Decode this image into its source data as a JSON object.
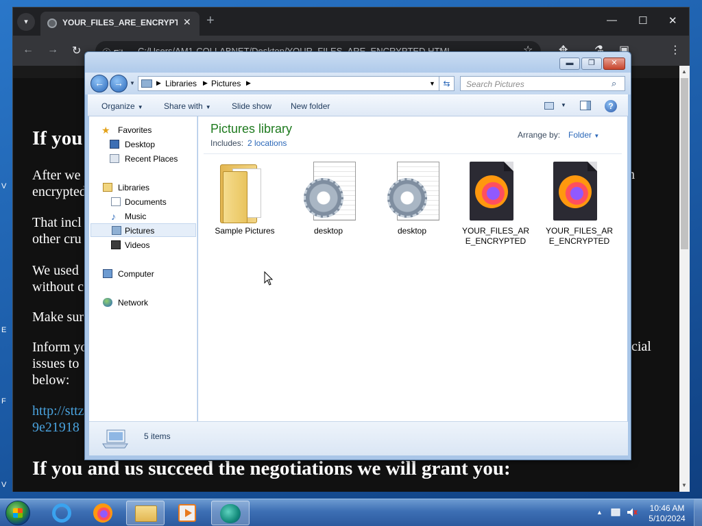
{
  "desktop": {
    "edge_letters": [
      "V",
      "E",
      "F",
      "V"
    ]
  },
  "chrome": {
    "tab": {
      "title": "YOUR_FILES_ARE_ENCRYPTED.H",
      "close": "✕"
    },
    "new_tab": "+",
    "window_controls": {
      "minimize": "—",
      "maximize": "☐",
      "close": "✕"
    },
    "toolbar": {
      "back": "←",
      "forward": "→",
      "reload": "↻",
      "info": "ⓘ File",
      "url": "C:/Users/AM1-COLLABNET/Desktop/YOUR_FILES_ARE_ENCRYPTED.HTML",
      "star": "☆",
      "icons": [
        "extensions-icon",
        "flask-icon",
        "sidepanel-icon",
        "profile-icon",
        "more-icon"
      ]
    },
    "page": {
      "heading1": "If you",
      "p1_line1": "After we",
      "p1_line2": "encrypted",
      "p2_line1": "That incl",
      "p2_line2": "other cru",
      "p3_line1": "We used",
      "p3_line2": "without c",
      "p4": "Make sur",
      "p5_line1": "Inform yo",
      "p5_line2": "issues to",
      "p5_line3": "below:",
      "p1_right": "n",
      "p5_right": "ncial",
      "link_line1": "http://sttz",
      "link_line2": "9e21918",
      "heading2": "If you and us succeed the negotiations we will grant you:"
    }
  },
  "explorer": {
    "caption_buttons": {
      "minimize": "▬",
      "maximize": "❐",
      "close": "✕"
    },
    "address": {
      "crumbs": [
        "Libraries",
        "Pictures"
      ],
      "separator": "▶"
    },
    "search_placeholder": "Search Pictures",
    "commands": {
      "organize": "Organize",
      "share_with": "Share with",
      "slide_show": "Slide show",
      "new_folder": "New folder",
      "help": "?"
    },
    "nav": {
      "favorites": "Favorites",
      "desktop": "Desktop",
      "recent_places": "Recent Places",
      "libraries": "Libraries",
      "documents": "Documents",
      "music": "Music",
      "pictures": "Pictures",
      "videos": "Videos",
      "computer": "Computer",
      "network": "Network"
    },
    "library": {
      "title": "Pictures library",
      "includes_label": "Includes:",
      "includes_link": "2 locations",
      "arrange_label": "Arrange by:",
      "arrange_value": "Folder"
    },
    "files": [
      {
        "name": "Sample Pictures",
        "icon": "folder-icon"
      },
      {
        "name": "desktop",
        "icon": "config-file-icon"
      },
      {
        "name": "desktop",
        "icon": "config-file-icon"
      },
      {
        "name": "YOUR_FILES_ARE_ENCRYPTED",
        "icon": "firefox-html-icon"
      },
      {
        "name": "YOUR_FILES_ARE_ENCRYPTED",
        "icon": "firefox-html-icon"
      }
    ],
    "status": {
      "count": "5 items"
    }
  },
  "taskbar": {
    "apps": [
      "internet-explorer-icon",
      "firefox-icon",
      "windows-explorer-icon",
      "media-player-icon",
      "app-icon"
    ],
    "clock": {
      "time": "10:46 AM",
      "date": "5/10/2024"
    }
  }
}
